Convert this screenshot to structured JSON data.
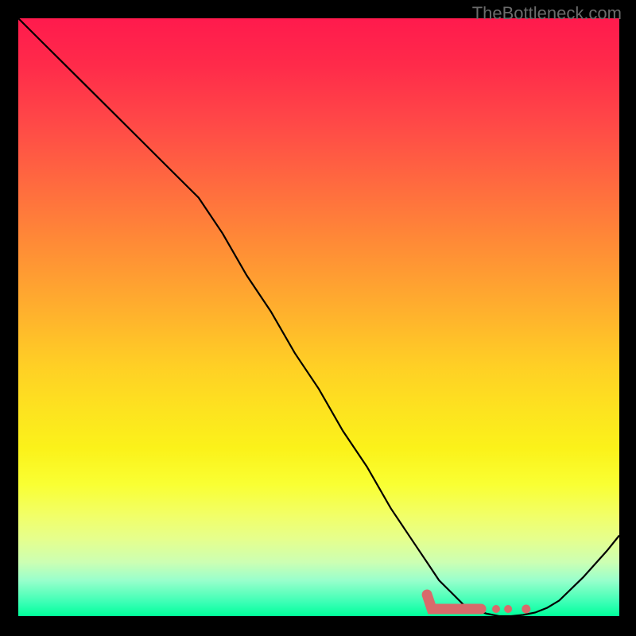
{
  "watermark": "TheBottleneck.com",
  "chart_data": {
    "type": "line",
    "title": "",
    "xlabel": "",
    "ylabel": "",
    "xlim": [
      0,
      100
    ],
    "ylim": [
      0,
      100
    ],
    "series": [
      {
        "name": "curve",
        "x": [
          0,
          4,
          8,
          12,
          16,
          20,
          24,
          28,
          30,
          34,
          38,
          42,
          46,
          50,
          54,
          58,
          62,
          66,
          68,
          70,
          72,
          74,
          76,
          78,
          80,
          82,
          84,
          86,
          88,
          90,
          94,
          98,
          100
        ],
        "y": [
          100,
          96,
          92,
          88,
          84,
          80,
          76,
          72,
          70,
          64,
          57,
          51,
          44,
          38,
          31,
          25,
          18,
          12,
          9,
          6,
          4,
          2,
          1,
          0.4,
          0,
          0,
          0.2,
          0.6,
          1.4,
          2.6,
          6.5,
          11,
          13.5
        ]
      }
    ],
    "markers": {
      "band_start_x": 68,
      "band_end_x": 77,
      "dots_x": [
        79.5,
        81.5,
        84.5
      ],
      "y": 1.2
    },
    "gradient_colors": {
      "top": "#ff1a4d",
      "mid_upper": "#ff8c36",
      "mid": "#ffcf25",
      "mid_lower": "#f9ff33",
      "bottom": "#00ff99"
    }
  }
}
